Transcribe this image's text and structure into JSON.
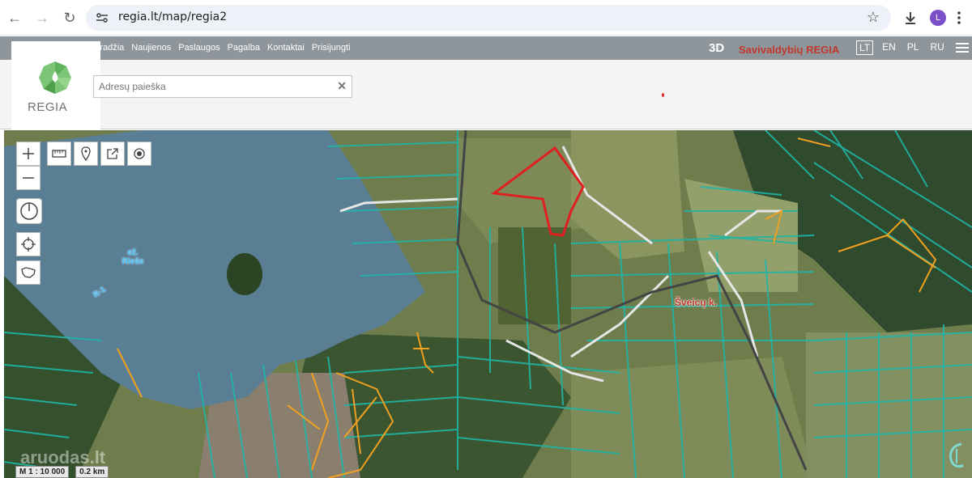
{
  "browser": {
    "url": "regia.lt/map/regia2",
    "profile_initial": "L"
  },
  "site": {
    "menu": [
      "Pradžia",
      "Naujienos",
      "Paslaugos",
      "Pagalba",
      "Kontaktai",
      "Prisijungti"
    ],
    "mode_3d": "3D",
    "brand": "Savivaldybių REGIA",
    "languages": [
      "LT",
      "EN",
      "PL",
      "RU"
    ],
    "active_language": "LT",
    "logo_text": "REGIA"
  },
  "search": {
    "placeholder": "Adresų paieška"
  },
  "map": {
    "lake_name": "ež. Rieše",
    "lake_code": "R-1",
    "village": "Šveicų k.",
    "scale_ratio": "M 1 : 10 000",
    "scale_bar": "0.2 km",
    "watermark": "aruodas.lt",
    "colors": {
      "parcel_border": "#1fb5a6",
      "road_highlight": "#f0a020",
      "selection": "#e02020",
      "water": "#5a7f95"
    }
  }
}
